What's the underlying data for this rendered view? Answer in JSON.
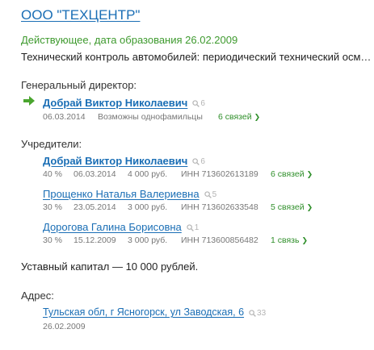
{
  "company": {
    "title": "ООО \"ТЕХЦЕНТР\"",
    "status": "Действующее, дата образования 26.02.2009",
    "activity": "Технический контроль автомобилей: периодический технический осмо..."
  },
  "director": {
    "heading": "Генеральный директор:",
    "name": "Добрай Виктор Николаевич",
    "search_count": "6",
    "date": "06.03.2014",
    "note": "Возможны однофамильцы",
    "links": "6 связей"
  },
  "founders": {
    "heading": "Учредители:",
    "items": [
      {
        "name": "Добрай Виктор Николаевич",
        "search_count": "6",
        "share": "40 %",
        "date": "06.03.2014",
        "amount": "4 000 руб.",
        "inn": "ИНН 713602613189",
        "links": "6 связей"
      },
      {
        "name": "Прощенко Наталья Валериевна",
        "search_count": "5",
        "share": "30 %",
        "date": "23.05.2014",
        "amount": "3 000 руб.",
        "inn": "ИНН 713602633548",
        "links": "5 связей"
      },
      {
        "name": "Дорогова Галина Борисовна",
        "search_count": "1",
        "share": "30 %",
        "date": "15.12.2009",
        "amount": "3 000 руб.",
        "inn": "ИНН 713600856482",
        "links": "1 связь"
      }
    ]
  },
  "capital": "Уставный капитал — 10 000 рублей.",
  "address": {
    "heading": "Адрес:",
    "value": "Тульская обл, г Ясногорск, ул Заводская, 6",
    "search_count": "33",
    "date": "26.02.2009"
  },
  "colors": {
    "link_blue": "#1a6eb5",
    "status_green": "#3e9a2e",
    "arrow_green": "#4aa52f"
  },
  "icons": {
    "current_arrow": "arrow-right-icon",
    "search": "search-icon",
    "chevron": "chevron-right-icon"
  }
}
